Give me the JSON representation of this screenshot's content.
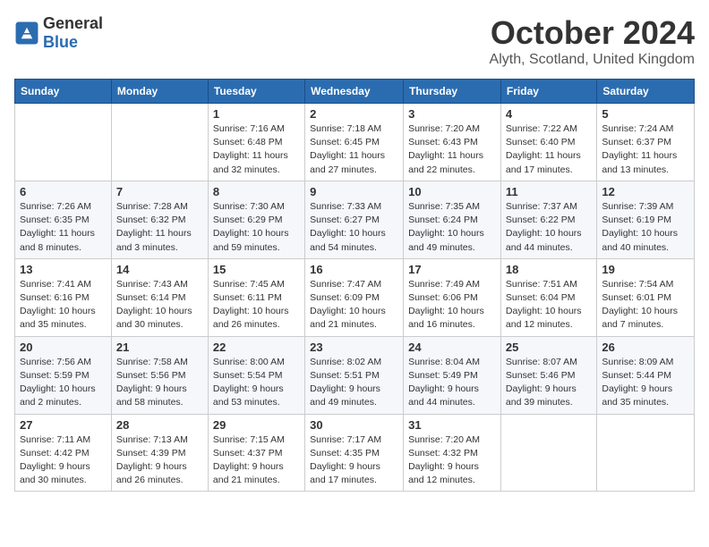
{
  "header": {
    "logo_general": "General",
    "logo_blue": "Blue",
    "month_title": "October 2024",
    "location": "Alyth, Scotland, United Kingdom"
  },
  "days_of_week": [
    "Sunday",
    "Monday",
    "Tuesday",
    "Wednesday",
    "Thursday",
    "Friday",
    "Saturday"
  ],
  "weeks": [
    [
      {
        "day": "",
        "sunrise": "",
        "sunset": "",
        "daylight": ""
      },
      {
        "day": "",
        "sunrise": "",
        "sunset": "",
        "daylight": ""
      },
      {
        "day": "1",
        "sunrise": "Sunrise: 7:16 AM",
        "sunset": "Sunset: 6:48 PM",
        "daylight": "Daylight: 11 hours and 32 minutes."
      },
      {
        "day": "2",
        "sunrise": "Sunrise: 7:18 AM",
        "sunset": "Sunset: 6:45 PM",
        "daylight": "Daylight: 11 hours and 27 minutes."
      },
      {
        "day": "3",
        "sunrise": "Sunrise: 7:20 AM",
        "sunset": "Sunset: 6:43 PM",
        "daylight": "Daylight: 11 hours and 22 minutes."
      },
      {
        "day": "4",
        "sunrise": "Sunrise: 7:22 AM",
        "sunset": "Sunset: 6:40 PM",
        "daylight": "Daylight: 11 hours and 17 minutes."
      },
      {
        "day": "5",
        "sunrise": "Sunrise: 7:24 AM",
        "sunset": "Sunset: 6:37 PM",
        "daylight": "Daylight: 11 hours and 13 minutes."
      }
    ],
    [
      {
        "day": "6",
        "sunrise": "Sunrise: 7:26 AM",
        "sunset": "Sunset: 6:35 PM",
        "daylight": "Daylight: 11 hours and 8 minutes."
      },
      {
        "day": "7",
        "sunrise": "Sunrise: 7:28 AM",
        "sunset": "Sunset: 6:32 PM",
        "daylight": "Daylight: 11 hours and 3 minutes."
      },
      {
        "day": "8",
        "sunrise": "Sunrise: 7:30 AM",
        "sunset": "Sunset: 6:29 PM",
        "daylight": "Daylight: 10 hours and 59 minutes."
      },
      {
        "day": "9",
        "sunrise": "Sunrise: 7:33 AM",
        "sunset": "Sunset: 6:27 PM",
        "daylight": "Daylight: 10 hours and 54 minutes."
      },
      {
        "day": "10",
        "sunrise": "Sunrise: 7:35 AM",
        "sunset": "Sunset: 6:24 PM",
        "daylight": "Daylight: 10 hours and 49 minutes."
      },
      {
        "day": "11",
        "sunrise": "Sunrise: 7:37 AM",
        "sunset": "Sunset: 6:22 PM",
        "daylight": "Daylight: 10 hours and 44 minutes."
      },
      {
        "day": "12",
        "sunrise": "Sunrise: 7:39 AM",
        "sunset": "Sunset: 6:19 PM",
        "daylight": "Daylight: 10 hours and 40 minutes."
      }
    ],
    [
      {
        "day": "13",
        "sunrise": "Sunrise: 7:41 AM",
        "sunset": "Sunset: 6:16 PM",
        "daylight": "Daylight: 10 hours and 35 minutes."
      },
      {
        "day": "14",
        "sunrise": "Sunrise: 7:43 AM",
        "sunset": "Sunset: 6:14 PM",
        "daylight": "Daylight: 10 hours and 30 minutes."
      },
      {
        "day": "15",
        "sunrise": "Sunrise: 7:45 AM",
        "sunset": "Sunset: 6:11 PM",
        "daylight": "Daylight: 10 hours and 26 minutes."
      },
      {
        "day": "16",
        "sunrise": "Sunrise: 7:47 AM",
        "sunset": "Sunset: 6:09 PM",
        "daylight": "Daylight: 10 hours and 21 minutes."
      },
      {
        "day": "17",
        "sunrise": "Sunrise: 7:49 AM",
        "sunset": "Sunset: 6:06 PM",
        "daylight": "Daylight: 10 hours and 16 minutes."
      },
      {
        "day": "18",
        "sunrise": "Sunrise: 7:51 AM",
        "sunset": "Sunset: 6:04 PM",
        "daylight": "Daylight: 10 hours and 12 minutes."
      },
      {
        "day": "19",
        "sunrise": "Sunrise: 7:54 AM",
        "sunset": "Sunset: 6:01 PM",
        "daylight": "Daylight: 10 hours and 7 minutes."
      }
    ],
    [
      {
        "day": "20",
        "sunrise": "Sunrise: 7:56 AM",
        "sunset": "Sunset: 5:59 PM",
        "daylight": "Daylight: 10 hours and 2 minutes."
      },
      {
        "day": "21",
        "sunrise": "Sunrise: 7:58 AM",
        "sunset": "Sunset: 5:56 PM",
        "daylight": "Daylight: 9 hours and 58 minutes."
      },
      {
        "day": "22",
        "sunrise": "Sunrise: 8:00 AM",
        "sunset": "Sunset: 5:54 PM",
        "daylight": "Daylight: 9 hours and 53 minutes."
      },
      {
        "day": "23",
        "sunrise": "Sunrise: 8:02 AM",
        "sunset": "Sunset: 5:51 PM",
        "daylight": "Daylight: 9 hours and 49 minutes."
      },
      {
        "day": "24",
        "sunrise": "Sunrise: 8:04 AM",
        "sunset": "Sunset: 5:49 PM",
        "daylight": "Daylight: 9 hours and 44 minutes."
      },
      {
        "day": "25",
        "sunrise": "Sunrise: 8:07 AM",
        "sunset": "Sunset: 5:46 PM",
        "daylight": "Daylight: 9 hours and 39 minutes."
      },
      {
        "day": "26",
        "sunrise": "Sunrise: 8:09 AM",
        "sunset": "Sunset: 5:44 PM",
        "daylight": "Daylight: 9 hours and 35 minutes."
      }
    ],
    [
      {
        "day": "27",
        "sunrise": "Sunrise: 7:11 AM",
        "sunset": "Sunset: 4:42 PM",
        "daylight": "Daylight: 9 hours and 30 minutes."
      },
      {
        "day": "28",
        "sunrise": "Sunrise: 7:13 AM",
        "sunset": "Sunset: 4:39 PM",
        "daylight": "Daylight: 9 hours and 26 minutes."
      },
      {
        "day": "29",
        "sunrise": "Sunrise: 7:15 AM",
        "sunset": "Sunset: 4:37 PM",
        "daylight": "Daylight: 9 hours and 21 minutes."
      },
      {
        "day": "30",
        "sunrise": "Sunrise: 7:17 AM",
        "sunset": "Sunset: 4:35 PM",
        "daylight": "Daylight: 9 hours and 17 minutes."
      },
      {
        "day": "31",
        "sunrise": "Sunrise: 7:20 AM",
        "sunset": "Sunset: 4:32 PM",
        "daylight": "Daylight: 9 hours and 12 minutes."
      },
      {
        "day": "",
        "sunrise": "",
        "sunset": "",
        "daylight": ""
      },
      {
        "day": "",
        "sunrise": "",
        "sunset": "",
        "daylight": ""
      }
    ]
  ]
}
